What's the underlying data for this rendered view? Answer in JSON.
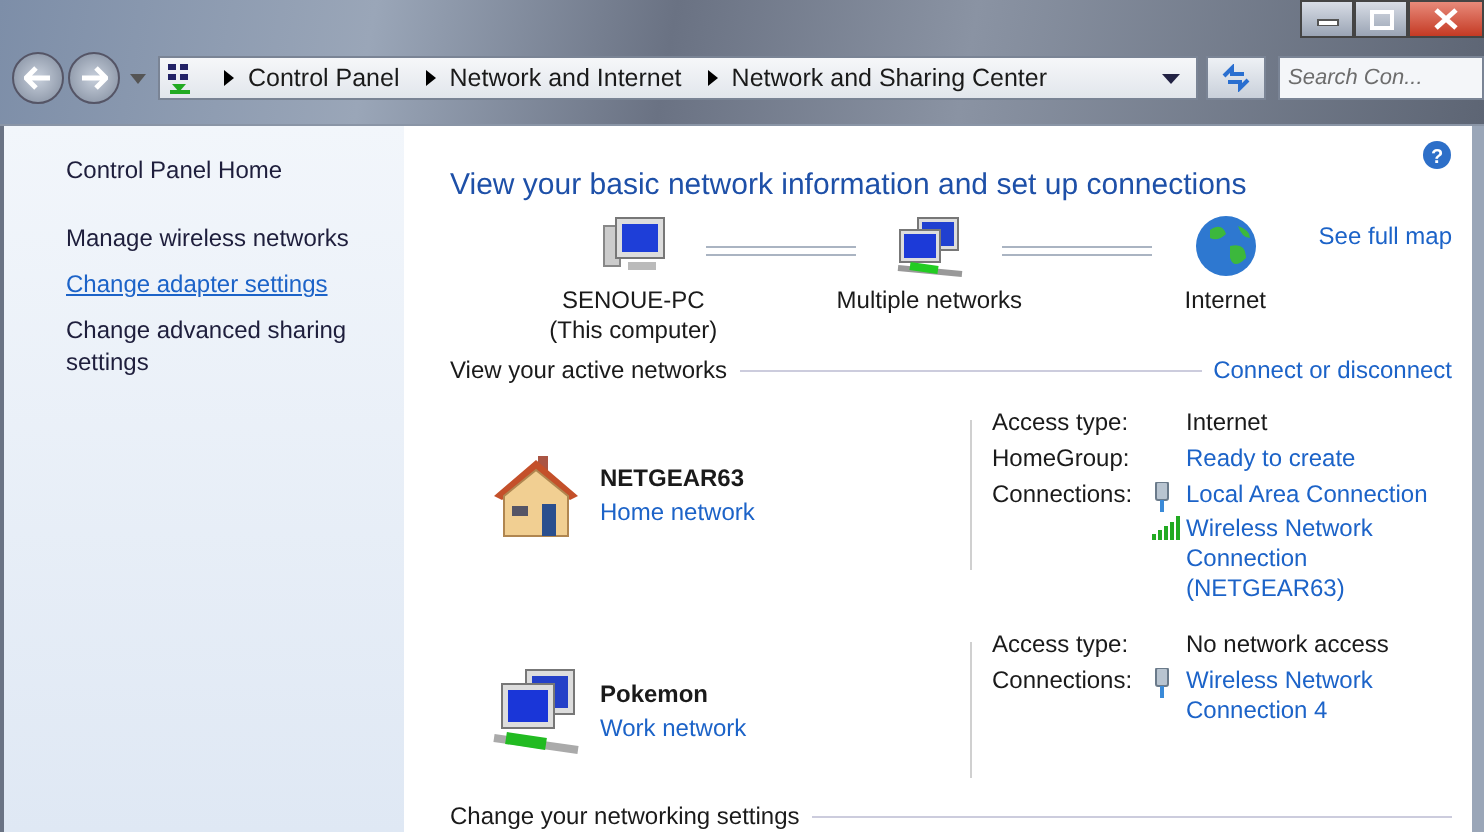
{
  "breadcrumb": [
    "Control Panel",
    "Network and Internet",
    "Network and Sharing Center"
  ],
  "search": {
    "placeholder": "Search Con..."
  },
  "sidebar": {
    "items": [
      {
        "label": "Control Panel Home",
        "link": false
      },
      {
        "label": "Manage wireless networks",
        "link": false
      },
      {
        "label": "Change adapter settings",
        "link": true
      },
      {
        "label": "Change advanced sharing settings",
        "link": false
      }
    ]
  },
  "title": "View your basic network information and set up connections",
  "map": {
    "nodes": [
      {
        "kind": "computer",
        "label": "SENOUE-PC",
        "sublabel": "(This computer)"
      },
      {
        "kind": "networks",
        "label": "Multiple networks"
      },
      {
        "kind": "globe",
        "label": "Internet"
      }
    ],
    "link": "See full map"
  },
  "active_heading": "View your active networks",
  "active_link": "Connect or disconnect",
  "networks": [
    {
      "kind": "home",
      "name": "NETGEAR63",
      "type": "Home network",
      "details": [
        {
          "label": "Access type:",
          "value": "Internet",
          "link": false
        },
        {
          "label": "HomeGroup:",
          "value": "Ready to create",
          "link": true
        }
      ],
      "connections_label": "Connections:",
      "connections": [
        {
          "kind": "wired",
          "name": "Local Area Connection"
        },
        {
          "kind": "wireless",
          "name": "Wireless Network Connection (NETGEAR63)"
        }
      ]
    },
    {
      "kind": "work",
      "name": "Pokemon",
      "type": "Work network",
      "details": [
        {
          "label": "Access type:",
          "value": "No network access",
          "link": false
        }
      ],
      "connections_label": "Connections:",
      "connections": [
        {
          "kind": "wired",
          "name": "Wireless Network Connection 4"
        }
      ]
    }
  ],
  "help": "?",
  "settings_heading": "Change your networking settings"
}
